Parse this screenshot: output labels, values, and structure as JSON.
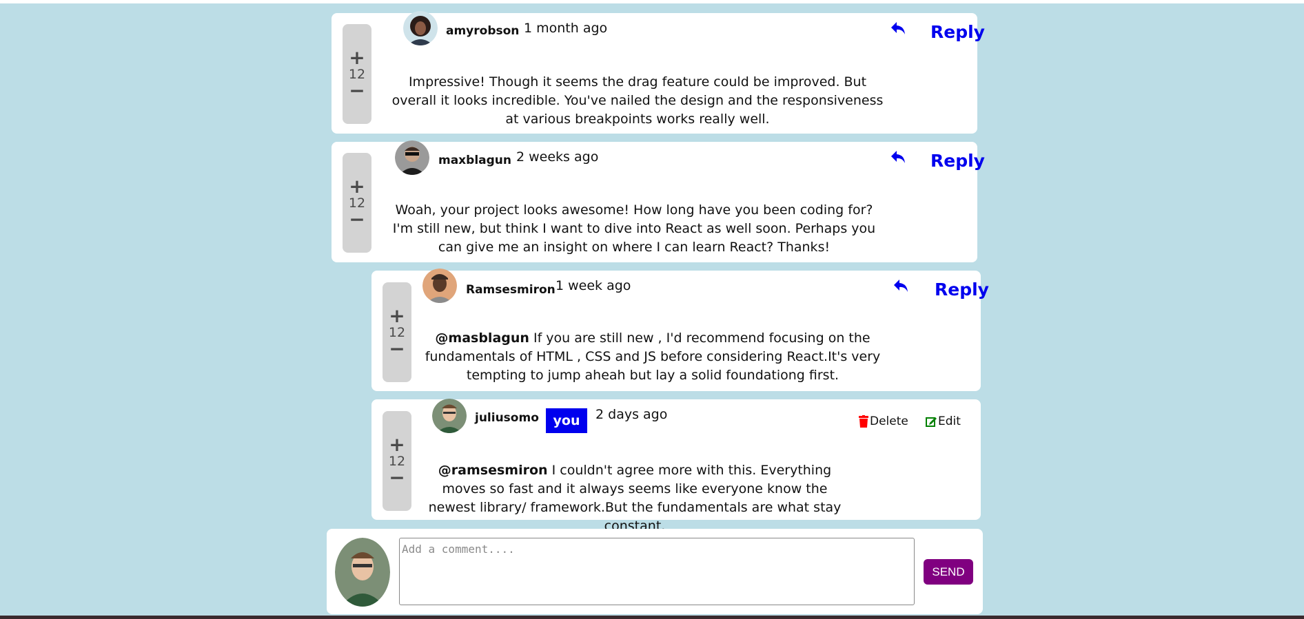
{
  "comments": [
    {
      "username": "amyrobson",
      "time": "1 month ago",
      "score": "12",
      "reply_label": "Reply",
      "text": "Impressive! Though it seems the drag feature could be improved. But overall it looks incredible. You've nailed the design and the responsiveness at various breakpoints works really well."
    },
    {
      "username": "maxblagun",
      "time": "2 weeks ago",
      "score": "12",
      "reply_label": "Reply",
      "text": "Woah, your project looks awesome! How long have you been coding for? I'm still new, but think I want to dive into React as well soon. Perhaps you can give me an insight on where I can learn React? Thanks!"
    },
    {
      "username": "Ramsesmiron",
      "time": "1 week ago",
      "score": "12",
      "reply_label": "Reply",
      "mention": "@masblagun",
      "text": " If you are still new , I'd recommend focusing on the fundamentals of HTML , CSS and JS before considering React.It's very tempting to jump aheah but lay a solid foundationg first."
    },
    {
      "username": "juliusomo",
      "badge": "you",
      "time": "2 days ago",
      "score": "12",
      "delete_label": "Delete",
      "edit_label": "Edit",
      "mention": "@ramsesmiron",
      "text": " I couldn't agree more with this. Everything moves so fast and it always seems like everyone know the newest library/ framework.But the fundamentals are what stay constant."
    }
  ],
  "vote": {
    "plus": "+",
    "minus": "−"
  },
  "composer": {
    "placeholder": "Add a comment....",
    "send_label": "SEND"
  },
  "colors": {
    "background": "#bcdde6",
    "reply": "#0000ee",
    "badge": "#0000ee",
    "send": "#800080",
    "delete": "#ff0000",
    "edit": "#008000"
  },
  "icons": [
    "reply-icon",
    "trash-icon",
    "edit-icon"
  ]
}
